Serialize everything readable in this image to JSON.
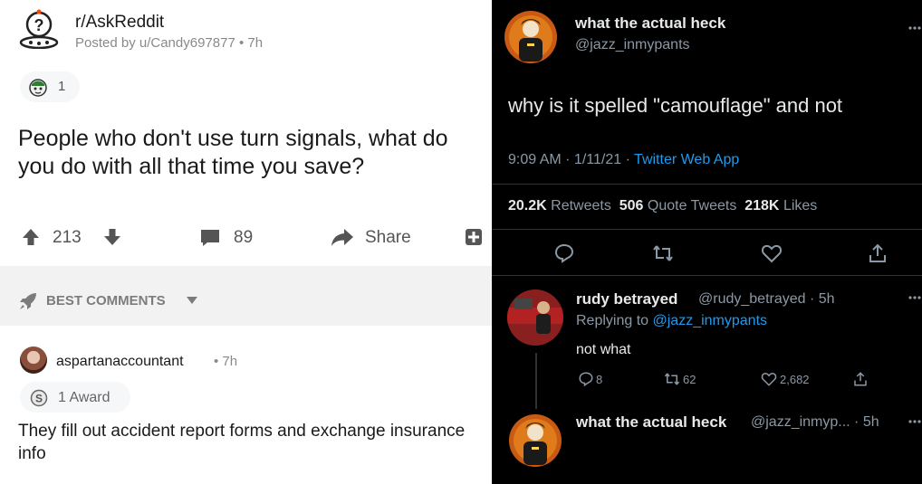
{
  "reddit": {
    "subreddit": "r/AskReddit",
    "posted_by": "Posted by u/Candy697877 • 7h",
    "award_count": "1",
    "title": "People who don't use turn signals, what do you do with all that time you save?",
    "vote_count": "213",
    "comment_count": "89",
    "share_label": "Share",
    "sort_label": "BEST COMMENTS",
    "comment": {
      "author": "aspartanaccountant",
      "time": "• 7h",
      "award_label": "1 Award",
      "body": "They fill out accident report forms and exchange insurance info"
    }
  },
  "twitter": {
    "tweet": {
      "name": "what the actual heck",
      "handle": "@jazz_inmypants",
      "text": "why is it spelled \"camouflage\" and not",
      "time": "9:09 AM · 1/11/21 · ",
      "app": "Twitter Web App",
      "retweets": "20.2K",
      "retweets_label": "Retweets",
      "quote_tweets": "506",
      "quote_tweets_label": "Quote Tweets",
      "likes": "218K",
      "likes_label": "Likes"
    },
    "reply": {
      "name": "rudy betrayed",
      "handle_time": "@rudy_betrayed · 5h",
      "replying_prefix": "Replying to ",
      "replying_to": "@jazz_inmypants",
      "text": "not what",
      "replies": "8",
      "retweets": "62",
      "likes": "2,682"
    },
    "reply2": {
      "name": "what the actual heck",
      "handle_time": "@jazz_inmyp... · 5h"
    }
  },
  "colors": {
    "reddit_bg": "#ffffff",
    "twitter_bg": "#000000",
    "twitter_link": "#1d9bf0",
    "muted": "#8b98a5"
  },
  "icons": [
    "reddit-snoo-icon",
    "award-icon",
    "upvote-icon",
    "downvote-icon",
    "comment-icon",
    "share-icon",
    "save-icon",
    "rocket-icon",
    "caret-down-icon",
    "silver-award-icon",
    "reply-icon",
    "retweet-icon",
    "like-icon",
    "share-tweet-icon",
    "more-icon"
  ]
}
